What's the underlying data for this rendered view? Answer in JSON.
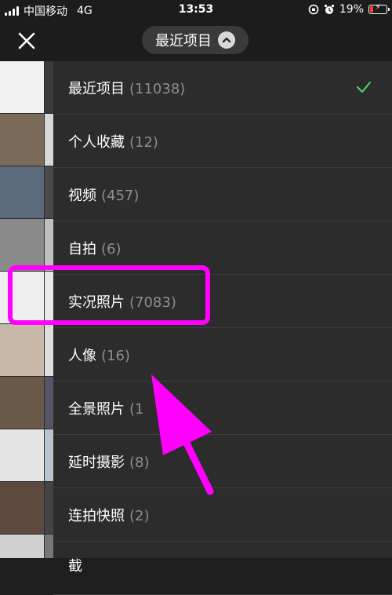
{
  "status_bar": {
    "carrier": "中国移动",
    "network": "4G",
    "time": "13:53",
    "battery_percent": "19%",
    "battery_level": 0.19
  },
  "header": {
    "title": "最近项目",
    "close_icon": "close-icon",
    "selector_icon": "chevron-up-icon"
  },
  "albums": [
    {
      "name": "最近项目",
      "count": "(11038)",
      "selected": true
    },
    {
      "name": "个人收藏",
      "count": "(12)",
      "selected": false
    },
    {
      "name": "视频",
      "count": "(457)",
      "selected": false
    },
    {
      "name": "自拍",
      "count": "(6)",
      "selected": false
    },
    {
      "name": "实况照片",
      "count": "(7083)",
      "selected": false
    },
    {
      "name": "人像",
      "count": "(16)",
      "selected": false
    },
    {
      "name": "全景照片",
      "count": "(1",
      "selected": false
    },
    {
      "name": "延时摄影",
      "count": "(8)",
      "selected": false
    },
    {
      "name": "连拍快照",
      "count": "(2)",
      "selected": false
    },
    {
      "name": "截",
      "count": "",
      "selected": false
    }
  ],
  "colors": {
    "annotation": "#ff00ff",
    "check": "#4cd964",
    "count_text": "#8e8e8e",
    "list_bg": "#2c2c2c"
  }
}
